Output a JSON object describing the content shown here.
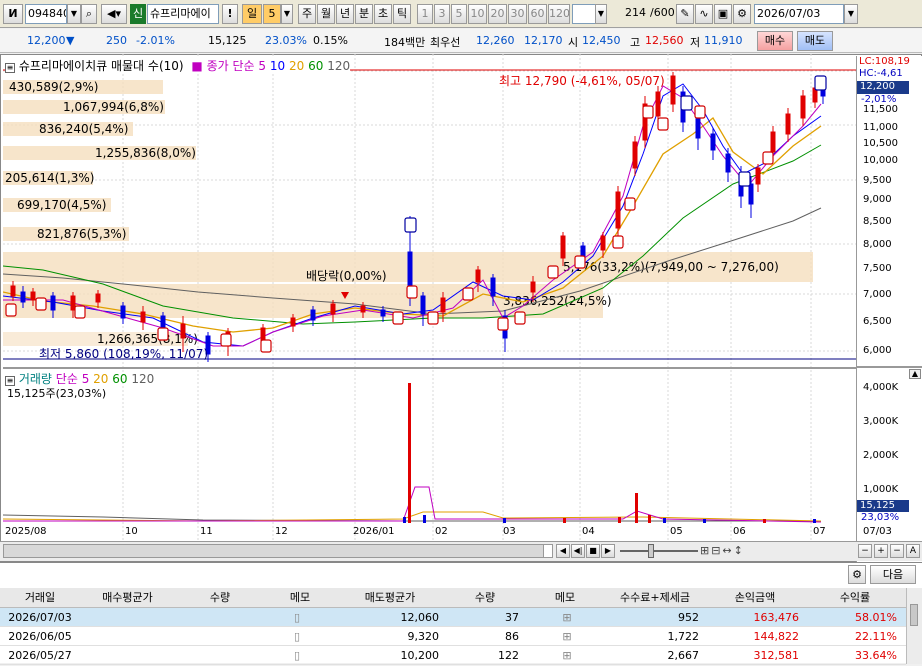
{
  "toolbar": {
    "code": "094840",
    "market_badge": "신",
    "stock_name": "슈프리마에이",
    "warning_badge": "!",
    "period_day": "일",
    "period_num": "5",
    "periods": [
      "주",
      "월",
      "년",
      "분",
      "초",
      "틱"
    ],
    "minute_options": [
      "1",
      "3",
      "5",
      "10",
      "20",
      "30",
      "60",
      "120"
    ],
    "count": "214",
    "count_total": "/600",
    "date": "2026/07/03"
  },
  "quote": {
    "price": "12,200",
    "change_arrow": "▼",
    "change": "250",
    "change_pct": "-2.01%",
    "volume": "15,125",
    "volume_ratio": "23.03%",
    "turnover": "0.15%",
    "amount": "184백만",
    "priority_sell_label": "최우선",
    "priority_sell": "12,260",
    "priority_buy": "12,170",
    "open_label": "시",
    "open": "12,450",
    "high_label": "고",
    "high": "12,560",
    "low_label": "저",
    "low": "11,910",
    "buy_button": "매수",
    "sell_button": "매도"
  },
  "price_panel": {
    "title": "슈프리마에이치큐 매물대 수(10)",
    "ma_label": "종가 단순",
    "ma_periods": [
      "5",
      "10",
      "20",
      "60",
      "120"
    ],
    "ma_colors": [
      "#c000c0",
      "#0000ff",
      "#e0a000",
      "#009000",
      "#606060"
    ],
    "high_annotation": "최고 12,790 (-4,61%, 05/07)",
    "low_annotation": "최저 5,860 (108,19%, 11/07)",
    "dividend_annotation": "배당락(0,00%)",
    "volume_profile": [
      "430,589(2,9%)",
      "1,067,994(6,8%)",
      "836,240(5,4%)",
      "1,255,836(8,0%)",
      "205,614(1,3%)",
      "699,170(4,5%)",
      "821,876(5,3%)",
      "5,176(33,2%)(7,949,00 ~ 7,276,00)",
      "3,836,252(24,5%)",
      "1,266,365(8,1%)"
    ],
    "lc_label": "LC:108,19",
    "hc_label": "HC:-4,61",
    "current_price": "12,200",
    "current_change": "-2,01%",
    "y_ticks": [
      "11,500",
      "11,000",
      "10,500",
      "10,000",
      "9,500",
      "9,000",
      "8,500",
      "8,000",
      "7,500",
      "7,000",
      "6,500",
      "6,000"
    ]
  },
  "volume_panel": {
    "title": "거래량",
    "ma_label": "단순",
    "ma_periods": [
      "5",
      "20",
      "60",
      "120"
    ],
    "current": "15,125주(23,03%)",
    "y_ticks": [
      "4,000K",
      "3,000K",
      "2,000K",
      "1,000K"
    ],
    "current_value": "15,125",
    "current_pct": "23,03%"
  },
  "x_axis": [
    "2025/08",
    "10",
    "11",
    "12",
    "2026/01",
    "02",
    "03",
    "04",
    "05",
    "06",
    "07",
    "07/03"
  ],
  "table": {
    "next_button": "다음",
    "columns": [
      "거래일",
      "매수평균가",
      "수량",
      "메모",
      "매도평균가",
      "수량",
      "메모",
      "수수료+제세금",
      "손익금액",
      "수익률"
    ],
    "rows": [
      {
        "date": "2026/07/03",
        "buy_avg": "",
        "buy_qty": "",
        "sell_avg": "12,060",
        "sell_qty": "37",
        "fee": "952",
        "pnl": "163,476",
        "rate": "58.01%"
      },
      {
        "date": "2026/06/05",
        "buy_avg": "",
        "buy_qty": "",
        "sell_avg": "9,320",
        "sell_qty": "86",
        "fee": "1,722",
        "pnl": "144,822",
        "rate": "22.11%"
      },
      {
        "date": "2026/05/27",
        "buy_avg": "",
        "buy_qty": "",
        "sell_avg": "10,200",
        "sell_qty": "122",
        "fee": "2,667",
        "pnl": "312,581",
        "rate": "33.64%"
      }
    ]
  }
}
